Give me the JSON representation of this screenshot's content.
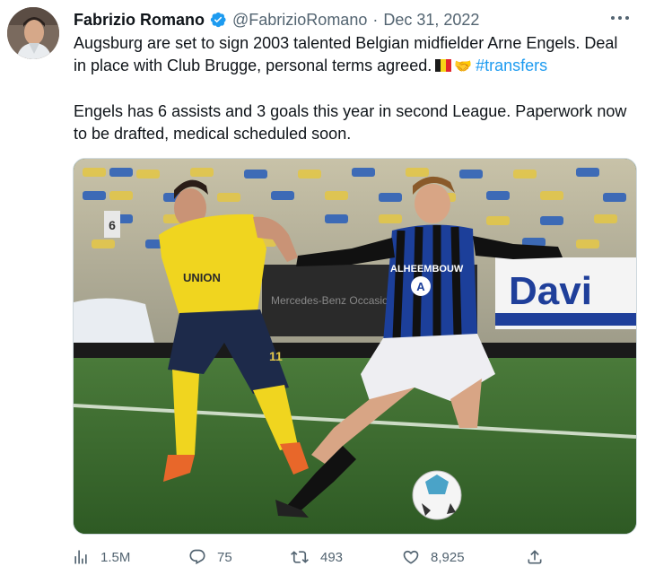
{
  "author": {
    "name": "Fabrizio Romano",
    "handle": "@FabrizioRomano",
    "separator": "·",
    "date": "Dec 31, 2022"
  },
  "tweet": {
    "paragraph1_text": "Augsburg are set to sign 2003 talented Belgian midfielder Arne Engels. Deal in place with Club Brugge, personal terms agreed.",
    "emoji_flag": "belgium-flag",
    "emoji_handshake": "handshake",
    "hashtag": "#transfers",
    "paragraph2": "Engels has 6 assists and 3 goals this year in second League. Paperwork now to be drafted, medical scheduled soon."
  },
  "media": {
    "sign_text": "Davi",
    "sponsor_text": "ALHEEMBOUW",
    "shirt_letter": "A",
    "yellow_shirt_text": "UNION",
    "post_number": "6",
    "shorts_number": "11"
  },
  "actions": {
    "views": "1.5M",
    "replies": "75",
    "retweets": "493",
    "likes": "8,925"
  },
  "colors": {
    "accent": "#1d9bf0",
    "text": "#0f1419",
    "secondary": "#536471"
  },
  "icons": [
    "verified-badge-icon",
    "more-icon",
    "views-icon",
    "reply-icon",
    "retweet-icon",
    "like-icon",
    "share-icon"
  ]
}
